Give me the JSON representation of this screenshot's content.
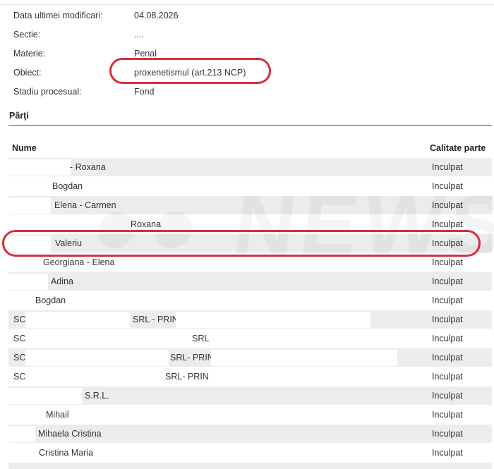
{
  "info": {
    "last_modified_label": "Data ultimei modificari:",
    "last_modified_value": "04.08.2026",
    "section_label": "Sectie:",
    "section_value": "....",
    "matter_label": "Materie:",
    "matter_value": "Penal",
    "object_label": "Obiect:",
    "object_value": "proxenetismul (art.213 NCP)",
    "stage_label": "Stadiu procesual:",
    "stage_value": "Fond"
  },
  "parties_section": {
    "title": "Părţi",
    "col_name": "Nume",
    "col_quality": "Calitate parte",
    "rows": [
      {
        "name": "- Roxana",
        "quality": "Inculpat"
      },
      {
        "name": "Bogdan",
        "quality": "Inculpat"
      },
      {
        "name": "Elena - Carmen",
        "quality": "Inculpat"
      },
      {
        "name": "Roxana",
        "quality": "Inculpat"
      },
      {
        "name": "Valeriu",
        "quality": "Inculpat"
      },
      {
        "name": "Georgiana - Elena",
        "quality": "Inculpat"
      },
      {
        "name": "Adina",
        "quality": "Inculpat"
      },
      {
        "name": "Bogdan",
        "quality": "Inculpat"
      },
      {
        "name_prefix": "SC",
        "name": "SRL - PRIN",
        "quality": "Inculpat"
      },
      {
        "name_prefix": "SC",
        "name": "SRL",
        "quality": "Inculpat"
      },
      {
        "name_prefix": "SC",
        "name": "SRL- PRIN",
        "quality": "Inculpat"
      },
      {
        "name_prefix": "SC",
        "name": "SRL- PRIN",
        "quality": "Inculpat"
      },
      {
        "name": "S.R.L.",
        "quality": "Inculpat"
      },
      {
        "name": "Mihail",
        "quality": "Inculpat"
      },
      {
        "name": "Mihaela Cristina",
        "quality": "Inculpat"
      },
      {
        "name": "Cristina Maria",
        "quality": "Inculpat"
      }
    ]
  },
  "colors": {
    "row_shade": "#ececec",
    "highlight": "#d32f3a",
    "text": "#333333"
  }
}
